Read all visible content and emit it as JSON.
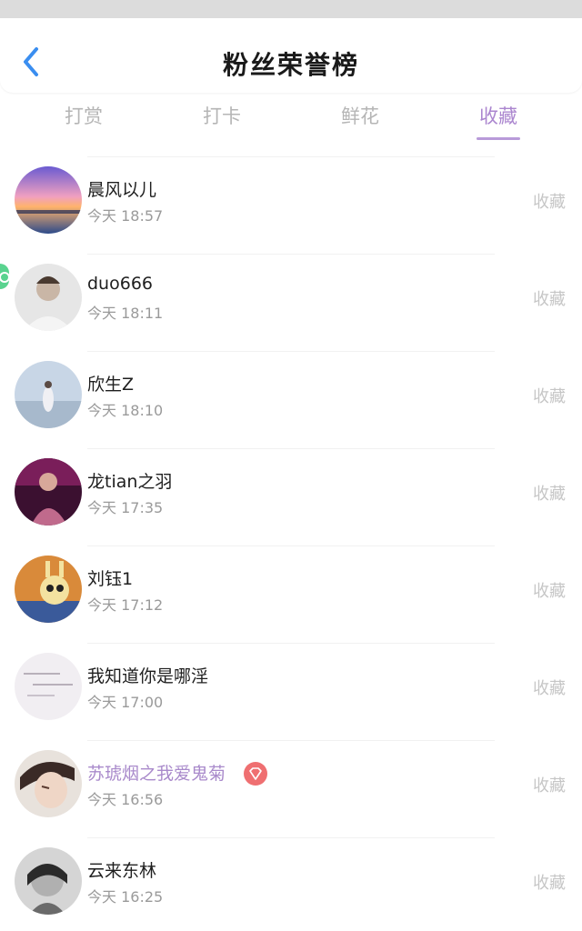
{
  "header": {
    "title": "粉丝荣誉榜",
    "back_icon": "chevron-left-icon"
  },
  "tabs": [
    {
      "label": "打赏",
      "active": false
    },
    {
      "label": "打卡",
      "active": false
    },
    {
      "label": "鲜花",
      "active": false
    },
    {
      "label": "收藏",
      "active": true
    }
  ],
  "colors": {
    "accent": "#ab86cf",
    "back_icon": "#3a8ef0",
    "badge": "#ef6f71"
  },
  "fans": [
    {
      "name": "晨风以儿",
      "time": "今天 18:57",
      "action": "收藏",
      "avatar": "sunset-avatar"
    },
    {
      "name": "duo666",
      "time": "今天 18:11",
      "action": "收藏",
      "avatar": "portrait-avatar"
    },
    {
      "name": "欣生Z",
      "time": "今天 18:10",
      "action": "收藏",
      "avatar": "seaside-avatar"
    },
    {
      "name": "龙tian之羽",
      "time": "今天 17:35",
      "action": "收藏",
      "avatar": "portrait-avatar"
    },
    {
      "name": "刘钰1",
      "time": "今天 17:12",
      "action": "收藏",
      "avatar": "cartoon-avatar"
    },
    {
      "name": "我知道你是哪淫",
      "time": "今天 17:00",
      "action": "收藏",
      "avatar": "text-avatar"
    },
    {
      "name": "苏琥烟之我爱鬼菊",
      "time": "今天 16:56",
      "action": "收藏",
      "avatar": "illustration-avatar",
      "vip": true,
      "badge_icon": "diamond-icon"
    },
    {
      "name": "云来东林",
      "time": "今天 16:25",
      "action": "收藏",
      "avatar": "portrait-avatar"
    }
  ]
}
